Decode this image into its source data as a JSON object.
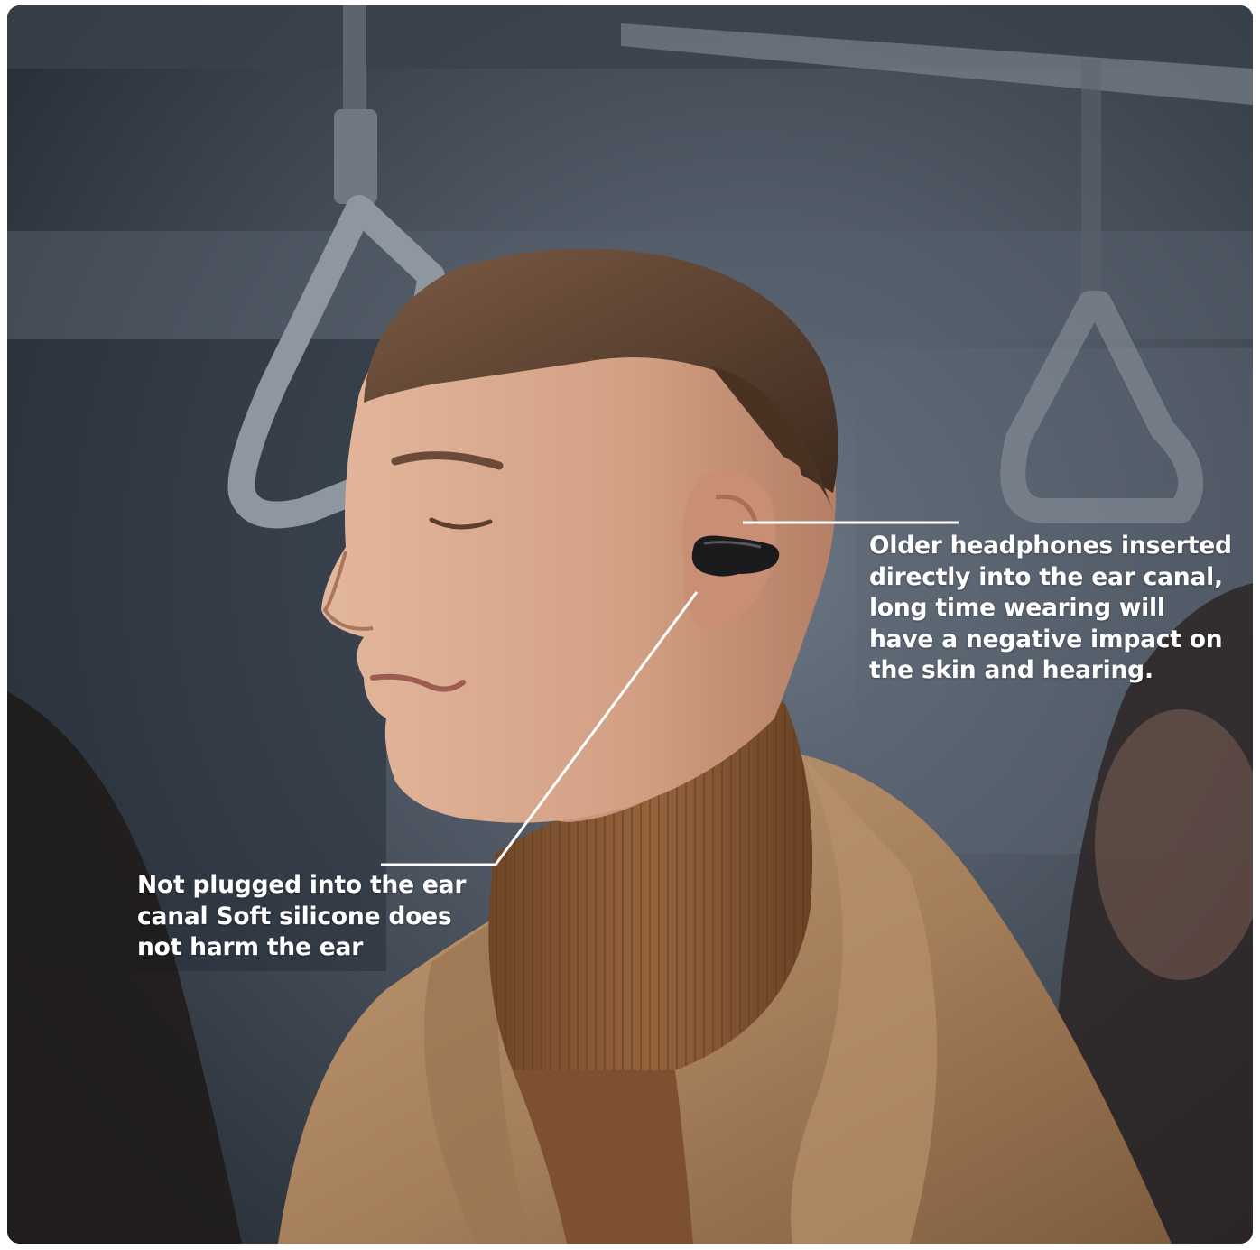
{
  "image": {
    "description_icon": "man-wearing-open-ear-earbud-photo"
  },
  "callouts": {
    "right": "Older headphones inserted\ndirectly into the ear canal,\nlong time wearing will\nhave a negative impact on\nthe skin and hearing.",
    "left": "Not plugged into the ear\ncanal Soft silicone does\nnot harm the ear"
  },
  "colors": {
    "coat": "#b08a66",
    "sweater": "#8a5a36",
    "skin": "#d7a88c",
    "hair": "#5a3f2e",
    "earbud": "#1b1b1e",
    "callout_line": "#ffffff"
  }
}
